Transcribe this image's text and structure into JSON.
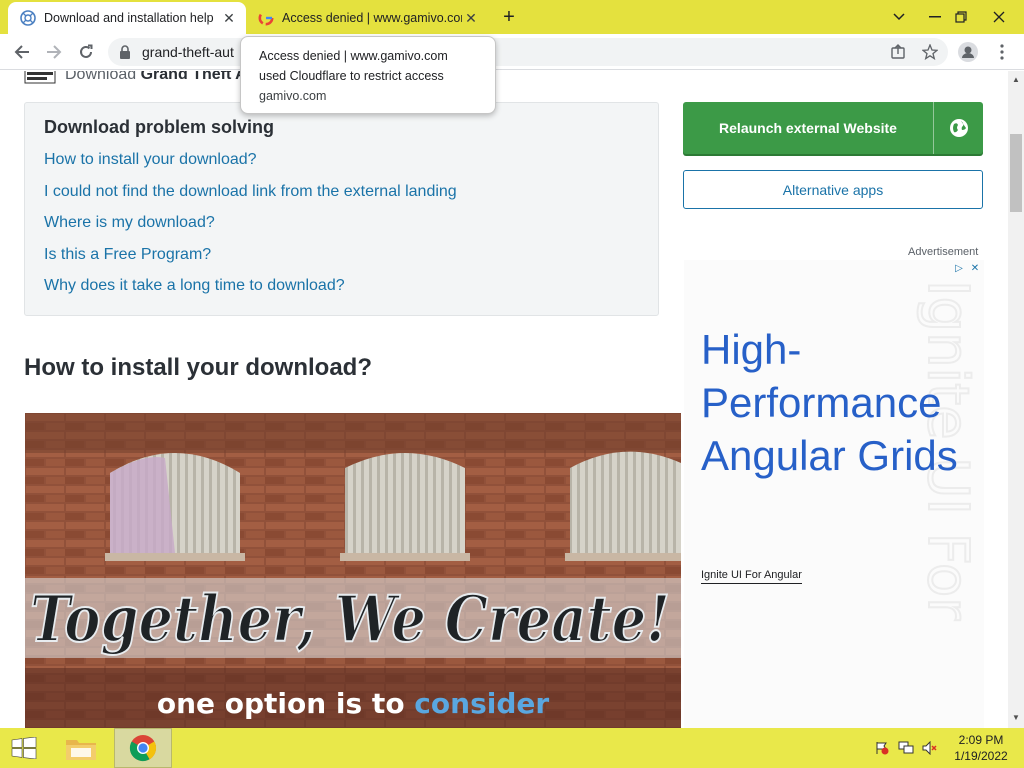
{
  "tabs": [
    {
      "title": "Download and installation help",
      "favicon": "help-icon",
      "active": true
    },
    {
      "title": "Access denied | www.gamivo.com",
      "favicon": "google-g-icon",
      "active": false
    }
  ],
  "window": {
    "minimize": "minimize-icon",
    "restore": "restore-icon",
    "close": "close-icon"
  },
  "toolbar": {
    "url": "grand-theft-aut"
  },
  "tooltip": {
    "line1": "Access denied | www.gamivo.com",
    "line2": "used Cloudflare to restrict access",
    "line3": "gamivo.com"
  },
  "page": {
    "download_prefix": "Download ",
    "download_title": "Grand Theft A",
    "problem_box": {
      "heading": "Download problem solving",
      "links": [
        "How to install your download?",
        "I could not find the download link from the external landing",
        "Where is my download?",
        "Is this a Free Program?",
        "Why does it take a long time to download?"
      ]
    },
    "section_heading": "How to install your download?",
    "photo": {
      "wall_text": "Together, We Create!",
      "caption_a": "one option is to ",
      "caption_b": "consider"
    },
    "relaunch_label": "Relaunch external Website",
    "alt_apps_label": "Alternative apps",
    "advertisement_label": "Advertisement",
    "ad": {
      "headline": "High-Performance Angular Grids",
      "brand": "Ignite UI For Angular",
      "watermark": "Ignite UI For"
    }
  },
  "taskbar": {
    "time": "2:09 PM",
    "date": "1/19/2022"
  },
  "colors": {
    "tabstrip": "#e4e13e",
    "taskbar": "#e9e84a",
    "link": "#1a73a8",
    "button_green": "#3c9a47",
    "ad_blue": "#2760c8"
  }
}
